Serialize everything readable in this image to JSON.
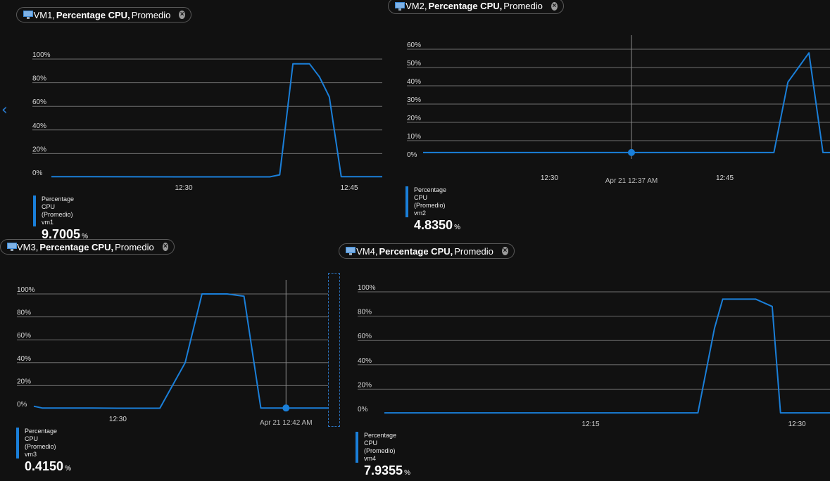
{
  "charts": [
    {
      "vm": "VM1",
      "metric": "Percentage CPU,",
      "agg": "Promedio",
      "vm_label": "VM1,",
      "legend_name": "Percentage CPU (Promedio)",
      "resource": "vm1",
      "value": "9.7005",
      "unit": "%",
      "hover_label": ""
    },
    {
      "vm": "VM2",
      "metric": "Percentage CPU,",
      "agg": "Promedio",
      "vm_label": "VM2,",
      "legend_name": "Percentage CPU (Promedio)",
      "resource": "vm2",
      "value": "4.8350",
      "unit": "%",
      "hover_label": "Apr 21 12:37 AM"
    },
    {
      "vm": "VM3",
      "metric": "Percentage CPU,",
      "agg": "Promedio",
      "vm_label": "VM3,",
      "legend_name": "Percentage CPU (Promedio)",
      "resource": "vm3",
      "value": "0.4150",
      "unit": "%",
      "hover_label": "Apr 21 12:42 AM"
    },
    {
      "vm": "VM4",
      "metric": "Percentage CPU,",
      "agg": "Promedio",
      "vm_label": "VM4,",
      "legend_name": "Percentage CPU (Promedio)",
      "resource": "vm4",
      "value": "7.9355",
      "unit": "%",
      "hover_label": ""
    }
  ],
  "icons": {
    "vm": "virtual-machine-icon",
    "close": "close-icon",
    "nav": "chevron-left-icon"
  },
  "colors": {
    "series": "#1a7fd9",
    "background": "#111111",
    "grid": "#6e6e6e"
  },
  "chart_data": [
    {
      "type": "line",
      "ylim": [
        0,
        100
      ],
      "yticks": [
        "100%",
        "80%",
        "60%",
        "40%",
        "20%",
        "0%"
      ],
      "xticks": [
        {
          "label": "12:30",
          "t": 12.5
        },
        {
          "label": "12:45",
          "t": 12.75
        }
      ],
      "xlim": [
        12.3,
        12.8
      ],
      "series": [
        {
          "points": [
            [
              12.3,
              0.5
            ],
            [
              12.5,
              0.3
            ],
            [
              12.6,
              0.3
            ],
            [
              12.63,
              0.3
            ],
            [
              12.645,
              2
            ],
            [
              12.665,
              96
            ],
            [
              12.69,
              96
            ],
            [
              12.705,
              85
            ],
            [
              12.72,
              68
            ],
            [
              12.738,
              0.5
            ],
            [
              12.8,
              0.5
            ]
          ]
        }
      ]
    },
    {
      "type": "line",
      "ylim": [
        0,
        60
      ],
      "yticks": [
        "60%",
        "50%",
        "40%",
        "30%",
        "20%",
        "10%",
        "0%"
      ],
      "xticks": [
        {
          "label": "12:30",
          "t": 12.5
        },
        {
          "label": "12:45",
          "t": 12.75
        }
      ],
      "xlim": [
        12.32,
        12.9
      ],
      "series": [
        {
          "points": [
            [
              12.32,
              3.5
            ],
            [
              12.5,
              3.5
            ],
            [
              12.75,
              3.5
            ],
            [
              12.82,
              3.5
            ],
            [
              12.84,
              42
            ],
            [
              12.855,
              50
            ],
            [
              12.87,
              58
            ],
            [
              12.89,
              3.5
            ],
            [
              12.9,
              3.5
            ]
          ]
        }
      ],
      "hover_t": 12.617
    },
    {
      "type": "line",
      "ylim": [
        0,
        100
      ],
      "yticks": [
        "100%",
        "80%",
        "60%",
        "40%",
        "20%",
        "0%"
      ],
      "xticks": [
        {
          "label": "12:30",
          "t": 12.5
        }
      ],
      "xlim": [
        12.4,
        12.75
      ],
      "series": [
        {
          "points": [
            [
              12.4,
              2
            ],
            [
              12.41,
              0.5
            ],
            [
              12.47,
              0.5
            ],
            [
              12.5,
              0.3
            ],
            [
              12.55,
              0.3
            ],
            [
              12.58,
              40
            ],
            [
              12.6,
              100
            ],
            [
              12.63,
              100
            ],
            [
              12.65,
              98
            ],
            [
              12.67,
              0.5
            ],
            [
              12.7,
              0.5
            ],
            [
              12.75,
              0.5
            ]
          ]
        }
      ],
      "hover_t": 12.7
    },
    {
      "type": "line",
      "ylim": [
        0,
        100
      ],
      "yticks": [
        "100%",
        "80%",
        "60%",
        "40%",
        "20%",
        "0%"
      ],
      "xticks": [
        {
          "label": "12:15",
          "t": 12.25
        },
        {
          "label": "12:30",
          "t": 12.5
        }
      ],
      "xlim": [
        12.0,
        12.54
      ],
      "series": [
        {
          "points": [
            [
              12.0,
              0.5
            ],
            [
              12.25,
              0.5
            ],
            [
              12.38,
              0.5
            ],
            [
              12.4,
              70
            ],
            [
              12.41,
              94
            ],
            [
              12.45,
              94
            ],
            [
              12.47,
              88
            ],
            [
              12.48,
              0.5
            ],
            [
              12.54,
              0.5
            ]
          ]
        }
      ]
    }
  ]
}
